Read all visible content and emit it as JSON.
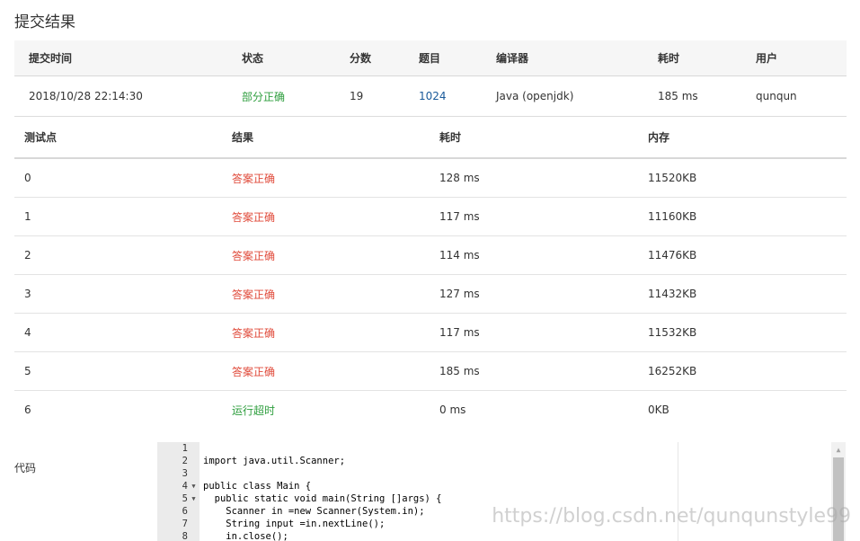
{
  "page": {
    "title": "提交结果"
  },
  "submission": {
    "headers": {
      "time": "提交时间",
      "status": "状态",
      "score": "分数",
      "problem": "题目",
      "compiler": "编译器",
      "cost": "耗时",
      "user": "用户"
    },
    "row": {
      "time": "2018/10/28 22:14:30",
      "status": "部分正确",
      "score": "19",
      "problem": "1024",
      "compiler": "Java (openjdk)",
      "cost": "185 ms",
      "user": "qunqun"
    }
  },
  "cases": {
    "headers": {
      "id": "测试点",
      "result": "结果",
      "time": "耗时",
      "memory": "内存"
    },
    "rows": [
      {
        "id": "0",
        "result": "答案正确",
        "time": "128 ms",
        "memory": "11520KB"
      },
      {
        "id": "1",
        "result": "答案正确",
        "time": "117 ms",
        "memory": "11160KB"
      },
      {
        "id": "2",
        "result": "答案正确",
        "time": "114 ms",
        "memory": "11476KB"
      },
      {
        "id": "3",
        "result": "答案正确",
        "time": "127 ms",
        "memory": "11432KB"
      },
      {
        "id": "4",
        "result": "答案正确",
        "time": "117 ms",
        "memory": "11532KB"
      },
      {
        "id": "5",
        "result": "答案正确",
        "time": "185 ms",
        "memory": "16252KB"
      },
      {
        "id": "6",
        "result": "运行超时",
        "time": "0 ms",
        "memory": "0KB"
      }
    ]
  },
  "code": {
    "label": "代码",
    "lines": [
      {
        "n": "1",
        "text": ""
      },
      {
        "n": "2",
        "text": "import java.util.Scanner;"
      },
      {
        "n": "3",
        "text": ""
      },
      {
        "n": "4",
        "text": "public class Main {"
      },
      {
        "n": "5",
        "text": "  public static void main(String []args) {"
      },
      {
        "n": "6",
        "text": "    Scanner in =new Scanner(System.in);"
      },
      {
        "n": "7",
        "text": "    String input =in.nextLine();"
      },
      {
        "n": "8",
        "text": "    in.close();"
      }
    ]
  },
  "colors": {
    "accepted": "#e04a3a",
    "partial": "#2e9e3e",
    "timeout": "#2e9e3e",
    "link": "#1a5a9a"
  },
  "watermark": "https://blog.csdn.net/qunqunstyle99"
}
